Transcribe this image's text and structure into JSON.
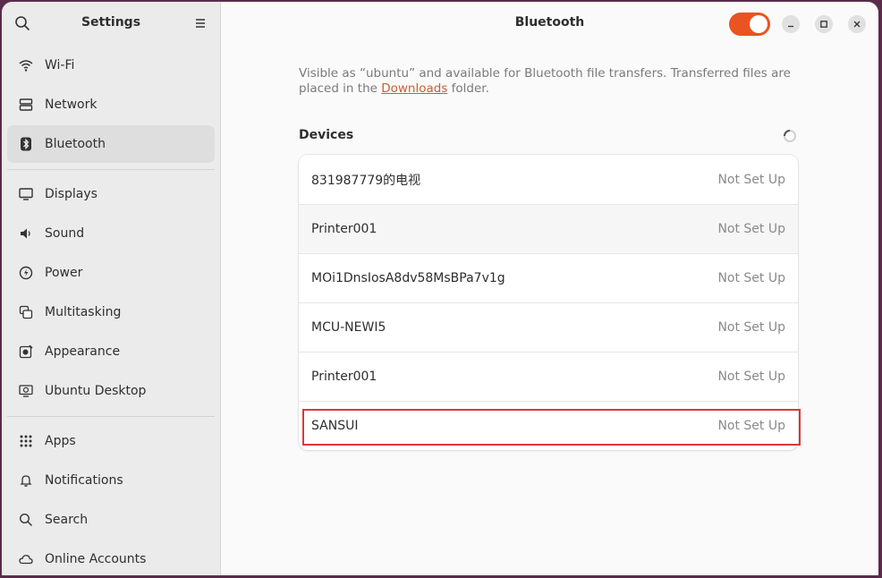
{
  "sidebar": {
    "title": "Settings",
    "items": [
      {
        "label": "Wi-Fi",
        "icon": "wifi-icon"
      },
      {
        "label": "Network",
        "icon": "network-icon"
      },
      {
        "label": "Bluetooth",
        "icon": "bluetooth-icon"
      },
      {
        "label": "Displays",
        "icon": "display-icon"
      },
      {
        "label": "Sound",
        "icon": "sound-icon"
      },
      {
        "label": "Power",
        "icon": "power-icon"
      },
      {
        "label": "Multitasking",
        "icon": "multitasking-icon"
      },
      {
        "label": "Appearance",
        "icon": "appearance-icon"
      },
      {
        "label": "Ubuntu Desktop",
        "icon": "ubuntu-desktop-icon"
      },
      {
        "label": "Apps",
        "icon": "apps-icon"
      },
      {
        "label": "Notifications",
        "icon": "bell-icon"
      },
      {
        "label": "Search",
        "icon": "search-icon"
      },
      {
        "label": "Online Accounts",
        "icon": "cloud-icon"
      }
    ],
    "active": "Bluetooth"
  },
  "main": {
    "title": "Bluetooth",
    "toggle_on": true,
    "accent": "#e95420",
    "desc_before": "Visible as “ubuntu” and available for Bluetooth file transfers. Transferred files are placed in the ",
    "desc_link": "Downloads",
    "desc_after": " folder.",
    "devices_label": "Devices",
    "devices": [
      {
        "name": "831987779的电视",
        "status": "Not Set Up"
      },
      {
        "name": "Printer001",
        "status": "Not Set Up"
      },
      {
        "name": "MOi1DnsIosA8dv58MsBPa7v1g",
        "status": "Not Set Up"
      },
      {
        "name": "MCU-NEWI5",
        "status": "Not Set Up"
      },
      {
        "name": "Printer001",
        "status": "Not Set Up"
      },
      {
        "name": "SANSUI",
        "status": "Not Set Up"
      }
    ]
  }
}
